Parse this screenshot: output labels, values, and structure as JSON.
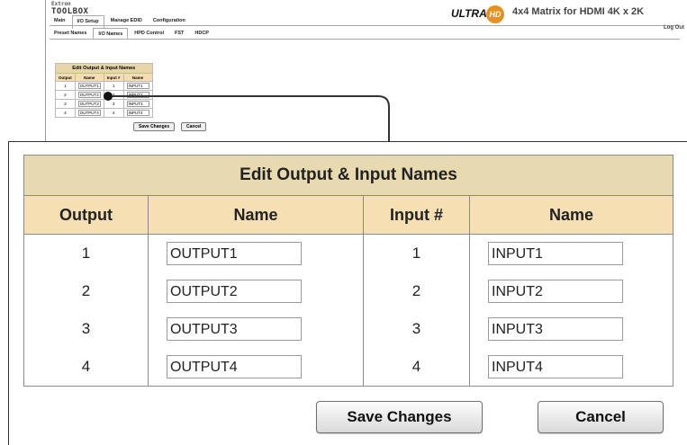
{
  "app": {
    "logo_top": "Extron",
    "logo_main": "TOOLBOX",
    "brand_ultra": "ULTRA",
    "brand_hd": "HD",
    "title": "4x4 Matrix for HDMI 4K x 2K",
    "logout": "Log Out"
  },
  "main_tabs": [
    {
      "label": "Main"
    },
    {
      "label": "I/O Setup"
    },
    {
      "label": "Manage EDID"
    },
    {
      "label": "Configuration"
    }
  ],
  "sub_tabs": [
    {
      "label": "Preset Names"
    },
    {
      "label": "I/O Names"
    },
    {
      "label": "HPD Control"
    },
    {
      "label": "FST"
    },
    {
      "label": "HDCP"
    }
  ],
  "editor": {
    "title": "Edit Output & Input Names",
    "col_output": "Output",
    "col_name": "Name",
    "col_input": "Input #",
    "col_name2": "Name",
    "rows": [
      {
        "output": "1",
        "output_name": "OUTPUT1",
        "input": "1",
        "input_name": "INPUT1"
      },
      {
        "output": "2",
        "output_name": "OUTPUT2",
        "input": "2",
        "input_name": "INPUT2"
      },
      {
        "output": "3",
        "output_name": "OUTPUT3",
        "input": "3",
        "input_name": "INPUT3"
      },
      {
        "output": "4",
        "output_name": "OUTPUT4",
        "input": "4",
        "input_name": "INPUT4"
      }
    ],
    "save_label": "Save Changes",
    "cancel_label": "Cancel"
  },
  "colors": {
    "title_bg": "#e8dab0",
    "header_bg": "#f6dfb3",
    "hd_badge": "#e8901e"
  }
}
